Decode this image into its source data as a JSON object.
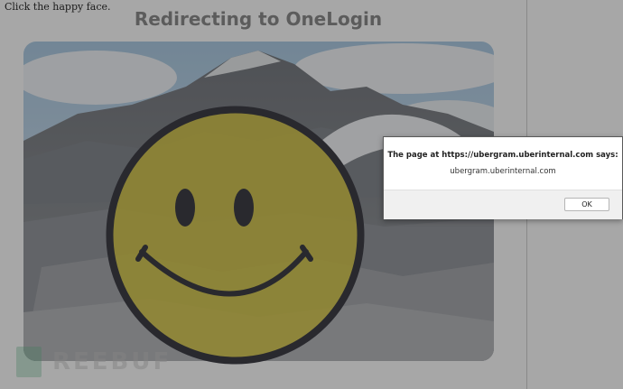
{
  "page": {
    "instruction": "Click the happy face.",
    "title": "Redirecting to OneLogin",
    "watermark_text": "REEBUF"
  },
  "dialog": {
    "title": "The page at https://ubergram.uberinternal.com says:",
    "message": "ubergram.uberinternal.com",
    "ok_label": "OK"
  },
  "icons": {
    "smiley": "smiley-face-icon",
    "watermark_logo": "freebuf-logo-icon"
  },
  "colors": {
    "overlay": "#3c3c3c",
    "smiley_fill": "#d6c42a",
    "smiley_outline": "#1a1a24",
    "title_text": "#777777"
  }
}
